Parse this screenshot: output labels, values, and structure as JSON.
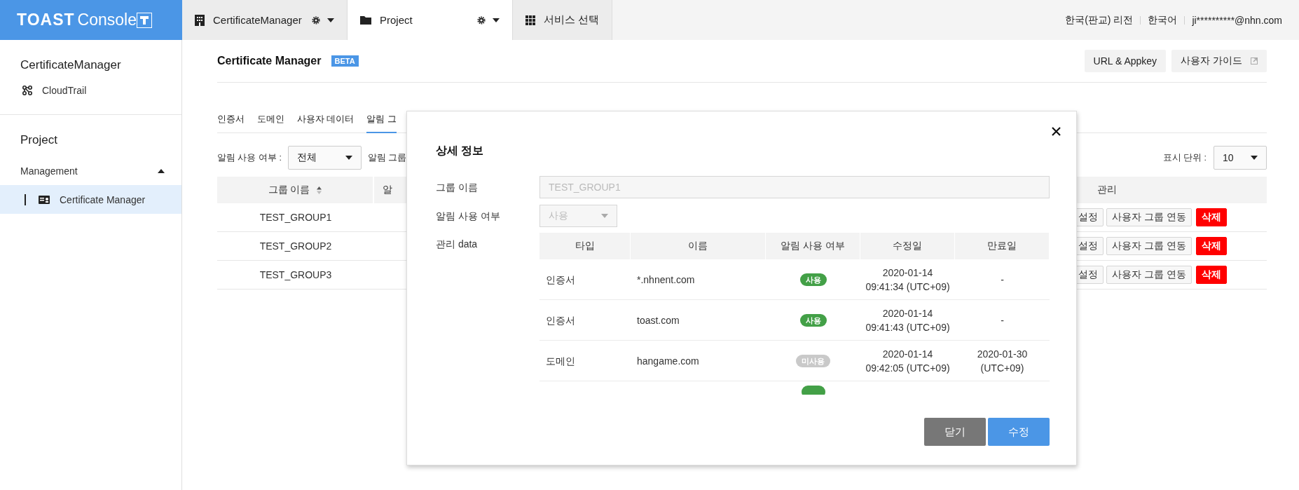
{
  "topbar": {
    "logo": {
      "brand": "TOAST",
      "product": "Console"
    },
    "tabs": [
      {
        "label": "CertificateManager",
        "kind": "org",
        "selected": false
      },
      {
        "label": "Project",
        "kind": "project",
        "selected": true
      },
      {
        "label": "서비스 선택",
        "kind": "service",
        "selected": false
      }
    ],
    "user_menu": [
      "한국(판교) 리전",
      "한국어",
      "ji**********@nhn.com"
    ]
  },
  "sidebar": {
    "service": {
      "title": "CertificateManager",
      "items": [
        {
          "label": "CloudTrail",
          "selected": false
        }
      ]
    },
    "project": {
      "title": "Project",
      "group": {
        "label": "Management",
        "expanded": true,
        "items": [
          {
            "label": "Certificate Manager",
            "selected": true
          }
        ]
      }
    }
  },
  "page": {
    "title": "Certificate Manager",
    "badge": "BETA",
    "buttons": [
      {
        "label": "URL & Appkey",
        "kind": "plain"
      },
      {
        "label": "사용자 가이드",
        "kind": "external"
      }
    ],
    "tabs": [
      {
        "label": "인증서",
        "selected": false
      },
      {
        "label": "도메인",
        "selected": false
      },
      {
        "label": "사용자 데이터",
        "selected": false
      },
      {
        "label": "알림 그",
        "selected": true
      }
    ],
    "filters": [
      {
        "label": "알림 사용 여부 :",
        "value": "전체"
      },
      {
        "label": "알림 그룹"
      }
    ],
    "page_size": {
      "label": "표시 단위 :",
      "value": "10"
    },
    "table": {
      "columns": [
        {
          "label": "그룹 이름",
          "sortable": true
        },
        {
          "label": "알",
          "sortable": false
        },
        {
          "label": "관리",
          "sortable": false
        }
      ],
      "rows": [
        {
          "group": "TEST_GROUP1",
          "actions": [
            {
              "label": "설정",
              "kind": "plain"
            },
            {
              "label": "사용자 그룹 연동",
              "kind": "plain"
            },
            {
              "label": "삭제",
              "kind": "danger"
            }
          ]
        },
        {
          "group": "TEST_GROUP2",
          "actions": [
            {
              "label": "설정",
              "kind": "plain"
            },
            {
              "label": "사용자 그룹 연동",
              "kind": "plain"
            },
            {
              "label": "삭제",
              "kind": "danger"
            }
          ]
        },
        {
          "group": "TEST_GROUP3",
          "actions": [
            {
              "label": "설정",
              "kind": "plain"
            },
            {
              "label": "사용자 그룹 연동",
              "kind": "plain"
            },
            {
              "label": "삭제",
              "kind": "danger"
            }
          ]
        }
      ]
    }
  },
  "modal": {
    "title": "상세 정보",
    "fields": [
      {
        "label": "그룹 이름",
        "kind": "text",
        "value": "TEST_GROUP1",
        "disabled": true
      },
      {
        "label": "알림 사용 여부",
        "kind": "select",
        "value": "사용",
        "disabled": true
      }
    ],
    "data_label": "관리 data",
    "table": {
      "columns": [
        "타입",
        "이름",
        "알림 사용 여부",
        "수정일",
        "만료일"
      ],
      "rows": [
        {
          "type": "인증서",
          "name": "*.nhnent.com",
          "notify": {
            "label": "사용",
            "on": true
          },
          "modified": "2020-01-14\n09:41:34 (UTC+09)",
          "expiry": "-"
        },
        {
          "type": "인증서",
          "name": "toast.com",
          "notify": {
            "label": "사용",
            "on": true
          },
          "modified": "2020-01-14\n09:41:43 (UTC+09)",
          "expiry": "-"
        },
        {
          "type": "도메인",
          "name": "hangame.com",
          "notify": {
            "label": "미사용",
            "on": false
          },
          "modified": "2020-01-14\n09:42:05 (UTC+09)",
          "expiry": "2020-01-30\n(UTC+09)"
        },
        {
          "notify": {
            "on": true
          }
        }
      ]
    },
    "buttons": [
      {
        "label": "닫기",
        "kind": "secondary"
      },
      {
        "label": "수정",
        "kind": "primary"
      }
    ]
  }
}
